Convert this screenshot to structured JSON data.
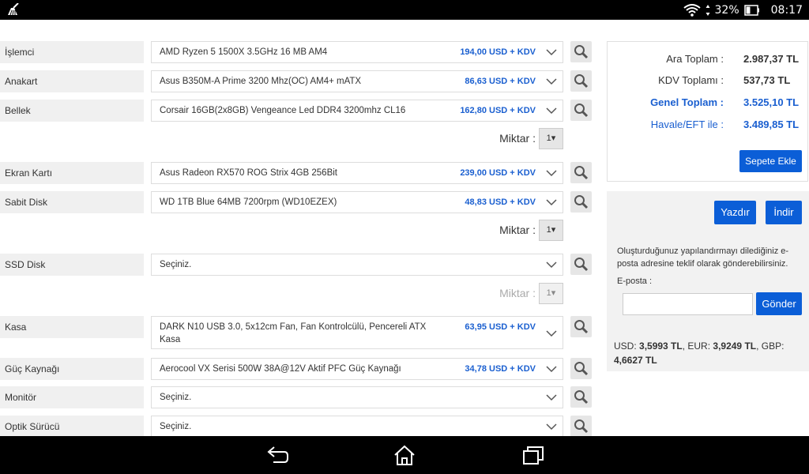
{
  "status_bar": {
    "battery": "32%",
    "time": "08:17"
  },
  "rows": [
    {
      "label": "İşlemci",
      "product": "AMD Ryzen 5 1500X 3.5GHz 16 MB AM4",
      "price": "194,00 USD + KDV"
    },
    {
      "label": "Anakart",
      "product": "Asus B350M-A Prime 3200 Mhz(OC) AM4+ mATX",
      "price": "86,63 USD + KDV"
    },
    {
      "label": "Bellek",
      "product": "Corsair 16GB(2x8GB) Vengeance Led DDR4 3200mhz CL16",
      "price": "162,80 USD + KDV"
    },
    {
      "label": "Ekran Kartı",
      "product": "Asus Radeon RX570 ROG Strix 4GB 256Bit",
      "price": "239,00 USD + KDV"
    },
    {
      "label": "Sabit Disk",
      "product": "WD 1TB Blue 64MB 7200rpm (WD10EZEX)",
      "price": "48,83 USD + KDV"
    },
    {
      "label": "SSD Disk",
      "product": "Seçiniz.",
      "price": ""
    },
    {
      "label": "Kasa",
      "product": "DARK N10 USB 3.0, 5x12cm Fan, Fan Kontrolcülü, Pencereli ATX Kasa",
      "price": "63,95 USD + KDV"
    },
    {
      "label": "Güç Kaynağı",
      "product": "Aerocool VX Serisi 500W 38A@12V Aktif PFC Güç Kaynağı",
      "price": "34,78 USD + KDV"
    },
    {
      "label": "Monitör",
      "product": "Seçiniz.",
      "price": ""
    },
    {
      "label": "Optik Sürücü",
      "product": "Seçiniz.",
      "price": ""
    }
  ],
  "quantity": {
    "label": "Miktar :",
    "value": "1▾"
  },
  "totals": {
    "subtotal_label": "Ara Toplam :",
    "subtotal_value": "2.987,37 TL",
    "vat_label": "KDV Toplamı :",
    "vat_value": "537,73 TL",
    "grand_label": "Genel Toplam :",
    "grand_value": "3.525,10 TL",
    "transfer_label": "Havale/EFT ile :",
    "transfer_value": "3.489,85 TL",
    "add_to_cart": "Sepete Ekle"
  },
  "actions": {
    "print": "Yazdır",
    "download": "İndir"
  },
  "share": {
    "text": "Oluşturduğunuz yapılandırmayı dilediğiniz e-posta adresine teklif olarak gönderebilirsiniz.",
    "email_label": "E-posta :",
    "send": "Gönder"
  },
  "rates": {
    "usd_label": "USD:",
    "usd": "3,5993 TL",
    "eur_label": ", EUR:",
    "eur": "3,9249 TL",
    "gbp_label": ", GBP:",
    "gbp": "4,6627 TL"
  },
  "colors": {
    "accent": "#0b5ed7",
    "price": "#1a5fd0",
    "status_bar": "#000000"
  }
}
